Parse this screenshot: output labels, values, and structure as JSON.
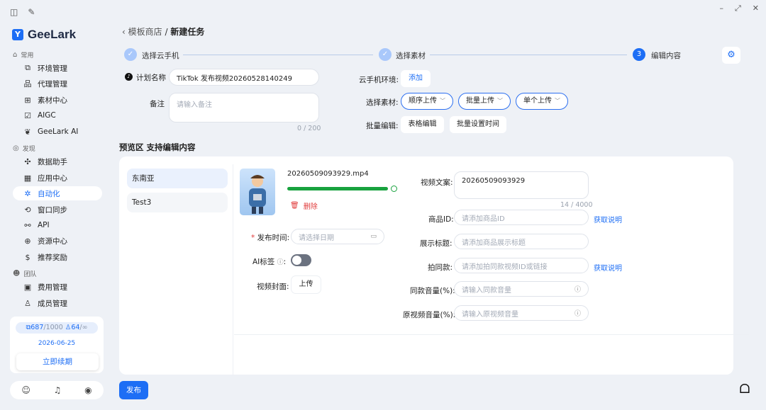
{
  "app": {
    "brand": "GeeLark",
    "brand_mark": "Y"
  },
  "window": {
    "min": "–",
    "max": "⤢",
    "close": "✕"
  },
  "sidebar": {
    "sections": [
      {
        "title": "常用",
        "icon": "home-icon"
      },
      {
        "title": "发现",
        "icon": "eye-icon"
      },
      {
        "title": "团队",
        "icon": "team-icon"
      }
    ],
    "items": [
      {
        "label": "环境管理",
        "icon": "window-icon"
      },
      {
        "label": "代理管理",
        "icon": "proxy-icon"
      },
      {
        "label": "素材中心",
        "icon": "material-icon"
      },
      {
        "label": "AIGC",
        "icon": "aigc-icon"
      },
      {
        "label": "GeeLark AI",
        "icon": "ai-icon"
      },
      {
        "label": "数据助手",
        "icon": "data-icon"
      },
      {
        "label": "应用中心",
        "icon": "apps-icon"
      },
      {
        "label": "自动化",
        "icon": "automation-icon"
      },
      {
        "label": "窗口同步",
        "icon": "sync-icon"
      },
      {
        "label": "API",
        "icon": "api-icon"
      },
      {
        "label": "资源中心",
        "icon": "resource-icon"
      },
      {
        "label": "推荐奖励",
        "icon": "reward-icon"
      },
      {
        "label": "费用管理",
        "icon": "billing-icon"
      },
      {
        "label": "成员管理",
        "icon": "member-icon"
      }
    ],
    "card": {
      "quota_used": "687",
      "quota_total": "/1000",
      "members_used": "64",
      "members_total": "/∞",
      "date": "2026-06-25",
      "renew_label": "立即续期"
    }
  },
  "breadcrumb": {
    "back": "‹",
    "parent": "模板商店",
    "sep": "/",
    "current": "新建任务"
  },
  "steps": [
    {
      "label": "选择云手机",
      "state": "done",
      "mark": "✓"
    },
    {
      "label": "选择素材",
      "state": "done",
      "mark": "✓"
    },
    {
      "label": "编辑内容",
      "state": "current",
      "mark": "3"
    }
  ],
  "form": {
    "plan_name_label": "计划名称",
    "plan_name_value": "TikTok 发布视频20260528140249",
    "note_label": "备注",
    "note_placeholder": "请输入备注",
    "note_count": "0 / 200",
    "env_label": "云手机环境:",
    "env_add": "添加",
    "material_label": "选择素材:",
    "material_pills": [
      "顺序上传",
      "批量上传",
      "单个上传"
    ],
    "batch_label": "批量编辑:",
    "batch_btns": [
      "表格编辑",
      "批量设置时间"
    ]
  },
  "preview": {
    "title": "预览区 支持编辑内容",
    "regions": [
      "东南亚",
      "Test3"
    ],
    "file_name": "20260509093929.mp4",
    "progress": 1.0,
    "delete_label": "删除",
    "publish_time_label": "发布时间:",
    "publish_time_placeholder": "请选择日期",
    "ai_label": "AI标签",
    "cover_label": "视频封面:",
    "cover_btn": "上传",
    "caption_label": "视频文案:",
    "caption_value": "20260509093929",
    "caption_count": "14 / 4000",
    "product_id_label": "商品ID:",
    "product_id_placeholder": "请添加商品ID",
    "get_help": "获取说明",
    "display_title_label": "展示标题:",
    "display_title_placeholder": "请添加商品展示标题",
    "same_label": "拍同款:",
    "same_placeholder": "请添加拍同款视频ID或链接",
    "same_volume_label": "同款音量(%):",
    "same_volume_placeholder": "请输入同款音量",
    "orig_volume_label": "原视频音量(%):",
    "orig_volume_placeholder": "请输入原视频音量"
  },
  "publish_label": "发布"
}
